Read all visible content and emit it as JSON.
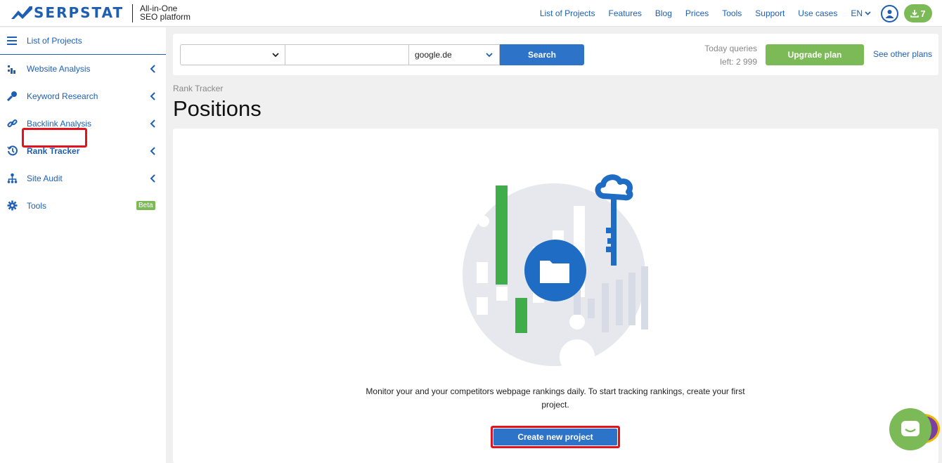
{
  "header": {
    "logo_text": "SERPSTAT",
    "tagline_line1": "All-in-One",
    "tagline_line2": "SEO platform",
    "nav": [
      "List of Projects",
      "Features",
      "Blog",
      "Prices",
      "Tools",
      "Support",
      "Use cases"
    ],
    "language": "EN",
    "downloads_count": "7"
  },
  "sidebar": {
    "items": [
      {
        "label": "List of Projects",
        "icon": "menu-icon"
      },
      {
        "label": "Website Analysis",
        "icon": "bar-chart-icon"
      },
      {
        "label": "Keyword Research",
        "icon": "key-icon"
      },
      {
        "label": "Backlink Analysis",
        "icon": "link-icon"
      },
      {
        "label": "Rank Tracker",
        "icon": "history-icon"
      },
      {
        "label": "Site Audit",
        "icon": "sitemap-icon"
      },
      {
        "label": "Tools",
        "icon": "gear-icon",
        "badge": "Beta"
      }
    ]
  },
  "search": {
    "search_type_value": "",
    "query_value": "",
    "engine_value": "google.de",
    "button_label": "Search",
    "queries_line1": "Today queries",
    "queries_line2": "left: 2 999",
    "upgrade_label": "Upgrade plan",
    "other_plans_label": "See other plans"
  },
  "page": {
    "breadcrumb": "Rank Tracker",
    "title": "Positions"
  },
  "empty_state": {
    "description": "Monitor your and your competitors webpage rankings daily. To start tracking rankings, create your first project.",
    "create_label": "Create new project"
  },
  "colors": {
    "brand_blue": "#1e5fb3",
    "button_blue": "#2d73c8",
    "green": "#7cba58",
    "highlight_red": "#e0131f"
  }
}
